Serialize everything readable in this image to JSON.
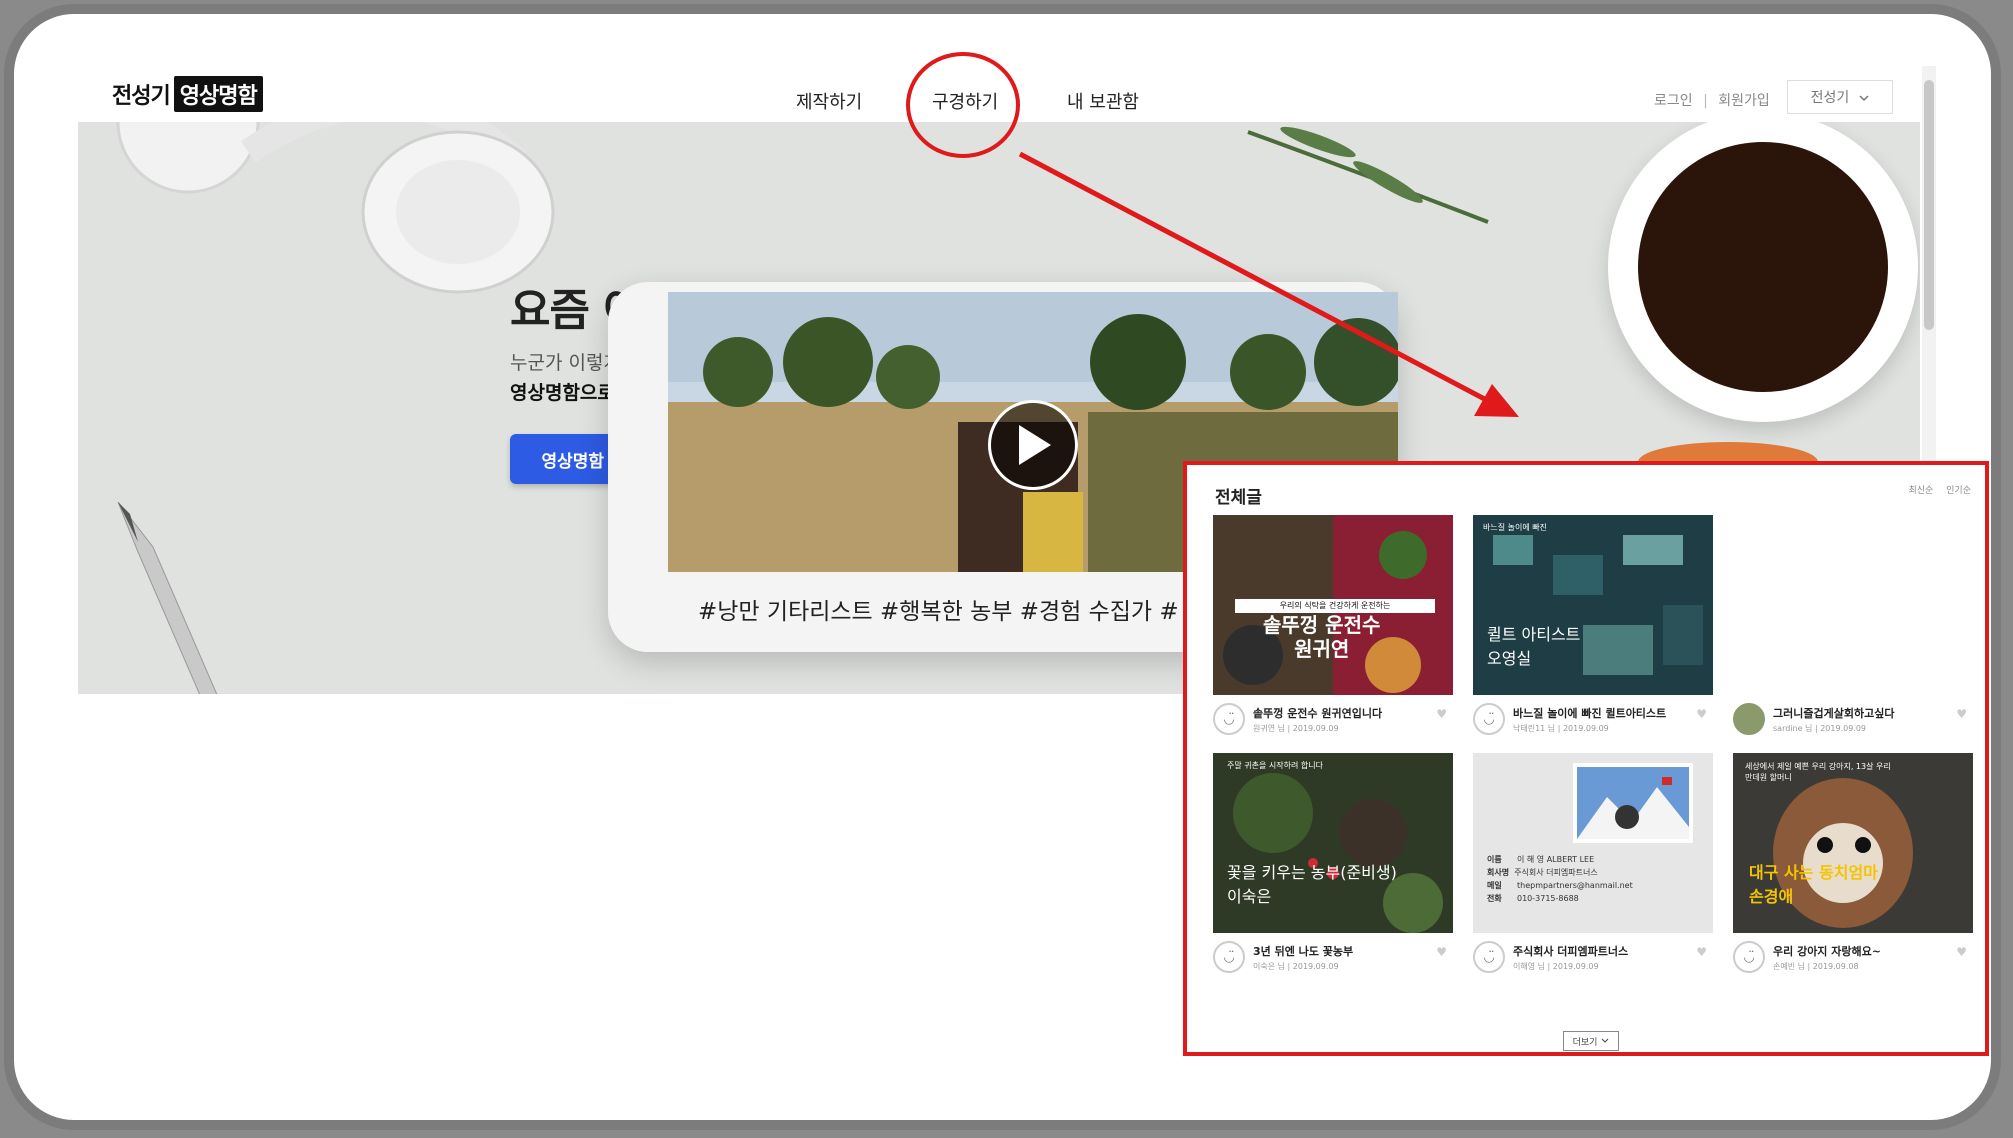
{
  "header": {
    "logo_a": "전성기",
    "logo_b": "영상명함",
    "nav": [
      "제작하기",
      "구경하기",
      "내 보관함"
    ],
    "login": "로그인",
    "separator": "|",
    "signup": "회원가입",
    "user_menu": "전성기",
    "user_menu_icon": "chevron-down-icon"
  },
  "hero": {
    "title": "요즘 어떻게 지내?",
    "sub1": "누군가 이렇게 물으면",
    "sub2": "영상명함으로 대답을",
    "cta": "영상명함 제작하기",
    "caption": "#낭만 기타리스트  #행복한 농부  #경험 수집가  #",
    "play_icon": "play-icon"
  },
  "panel": {
    "title": "전체글",
    "sort": [
      "최신순",
      "인기순"
    ],
    "cards": [
      {
        "title": "솥뚜껑 운전수 원귀연입니다",
        "author": "원귀연 님",
        "date": "2019.09.09",
        "overlay_top": "우리의 식탁을 건강하게 운전하는",
        "overlay": "솥뚜껑 운전수\n원귀연"
      },
      {
        "title": "바느질 놀이에 빠진 퀼트아티스트",
        "author": "낙태린11 님",
        "date": "2019.09.09",
        "overlay_top": "바느질 놀이에 빠진",
        "overlay": "퀼트 아티스트\n오영실"
      },
      {
        "title": "그러니즐겁게살회하고싶다",
        "author": "sardine 님",
        "date": "2019.09.09",
        "overlay_top": "",
        "overlay": ""
      },
      {
        "title": "3년 뒤엔 나도 꽃농부",
        "author": "이숙은 님",
        "date": "2019.09.09",
        "overlay_top": "주말 귀촌을 시작하려 합니다",
        "overlay": "꽃을 키우는 농부(준비생)\n이숙은"
      },
      {
        "title": "주식회사 더피엠파트너스",
        "author": "이해영 님",
        "date": "2019.09.09",
        "overlay_top": "",
        "overlay": ""
      },
      {
        "title": "우리 강아지 자랑해요~",
        "author": "손예빈 님",
        "date": "2019.09.08",
        "overlay_top": "세상에서 제일 예쁜 우리 강아지, 13살 우리 만데원 할머니",
        "overlay": "대구 사는 동치엄마\n손경애"
      }
    ],
    "namecard": {
      "name_label": "이름",
      "name": "이 해 영 ALBERT LEE",
      "company_label": "회사명",
      "company": "주식회사 더피엠파트너스",
      "email_label": "메일",
      "email": "thepmpartners@hanmail.net",
      "phone_label": "전화",
      "phone": "010-3715-8688"
    },
    "more": "더보기",
    "heart_icon": "heart-icon",
    "avatar_icon": "smiley-icon"
  },
  "colors": {
    "accent": "#2d5be3",
    "annotation": "#e01a1a"
  }
}
